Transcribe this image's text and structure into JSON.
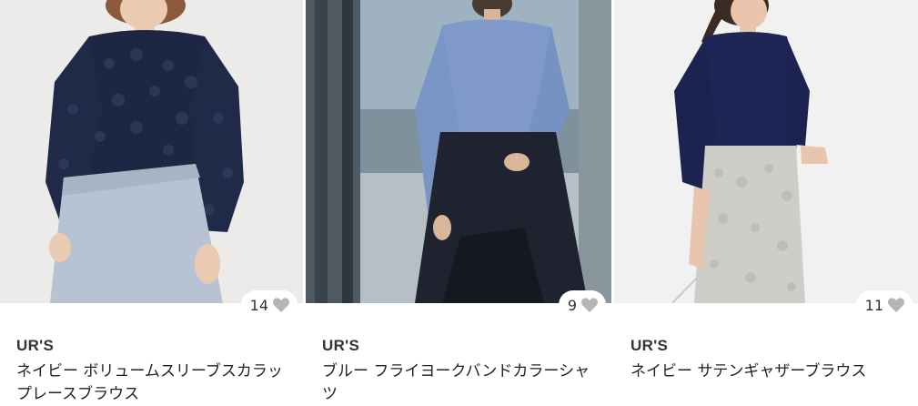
{
  "products": [
    {
      "brand": "UR'S",
      "name": "ネイビー ボリュームスリーブスカラップレースブラウス",
      "likes": "14",
      "heart_color": "#b5b5b5"
    },
    {
      "brand": "UR'S",
      "name": "ブルー フライヨークバンドカラーシャツ",
      "likes": "9",
      "heart_color": "#b5b5b5"
    },
    {
      "brand": "UR'S",
      "name": "ネイビー サテンギャザーブラウス",
      "likes": "11",
      "heart_color": "#b5b5b5"
    }
  ]
}
